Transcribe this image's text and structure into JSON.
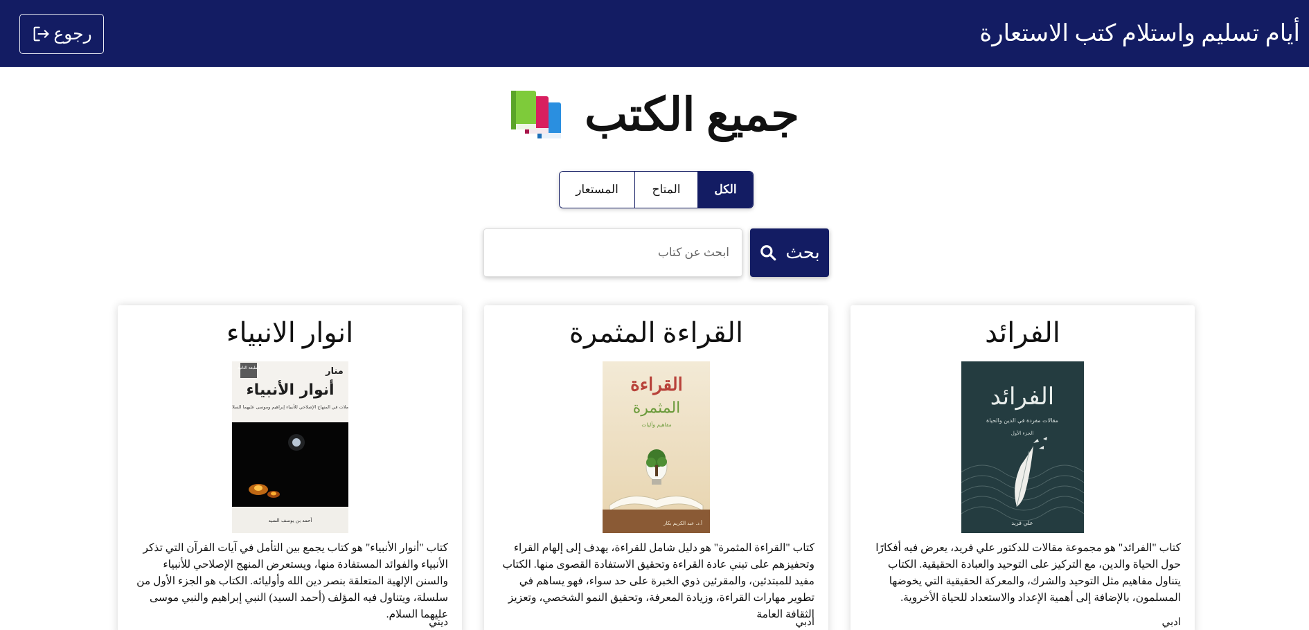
{
  "header": {
    "title": "أيام تسليم واستلام كتب الاستعارة",
    "back_label": "رجوع"
  },
  "page": {
    "title": "جميع الكتب",
    "title_icon": "books-stack-icon"
  },
  "filters": {
    "tabs": [
      {
        "label": "المستعار",
        "active": false
      },
      {
        "label": "المتاح",
        "active": false
      },
      {
        "label": "الكل",
        "active": true
      }
    ]
  },
  "search": {
    "placeholder": "ابحث عن كتاب",
    "button_label": "بحث"
  },
  "books": [
    {
      "title": "انوار الانبياء",
      "cover": {
        "publisher_mark": "منار",
        "edition_badge": "الطبعة الثانية",
        "heading": "أنوار الأنبياء",
        "subtitle": "تأملات في المنهاج الإصلاحي للأنبياء إبراهيم وموسى عليهما السلام",
        "author": "أحمد بن يوسف السيد"
      },
      "description": "كتاب \"أنوار الأنبياء\" هو كتاب يجمع بين التأمل في آيات القرآن التي تذكر الأنبياء والفوائد المستفادة منها، ويستعرض المنهج الإصلاحي للأنبياء والسنن الإلهية المتعلقة بنصر دين الله وأوليائه. الكتاب هو الجزء الأول من سلسلة، ويتناول فيه المؤلف (أحمد السيد) النبي إبراهيم والنبي موسى عليهما السلام.",
      "category": "ديني"
    },
    {
      "title": "القراءة المثمرة",
      "cover": {
        "heading_line1": "القراءة",
        "heading_line2": "المثمرة",
        "subtitle": "مفاهيم وآليات",
        "author": "أ.د. عبد الكريم بكار"
      },
      "description": "كتاب \"القراءة المثمرة\" هو دليل شامل للقراءة، يهدف إلى إلهام القراء وتحفيزهم على تبني عادة القراءة وتحقيق الاستفادة القصوى منها. الكتاب مفيد للمبتدئين، والمقرئين ذوي الخبرة على حد سواء، فهو يساهم في تطوير مهارات القراءة، وزيادة المعرفة، وتحقيق النمو الشخصي، وتعزيز الثقافة العامة",
      "category": "ادبي"
    },
    {
      "title": "الفرائد",
      "cover": {
        "heading": "الفرائد",
        "subtitle": "مقالات مفردة في الدين والحياة",
        "part": "الجزء الأول",
        "author": "علي فريد"
      },
      "description": "كتاب \"الفرائد\" هو مجموعة مقالات للدكتور علي فريد، يعرض فيه أفكارًا حول الحياة والدين، مع التركيز على التوحيد والعبادة الحقيقية. الكتاب يتناول مفاهيم مثل التوحيد والشرك، والمعركة الحقيقية التي يخوضها المسلمون، بالإضافة إلى أهمية الإعداد والاستعداد للحياة الأخروية.",
      "category": "ادبي"
    }
  ],
  "colors": {
    "primary": "#131c63",
    "background": "#ffffff"
  }
}
